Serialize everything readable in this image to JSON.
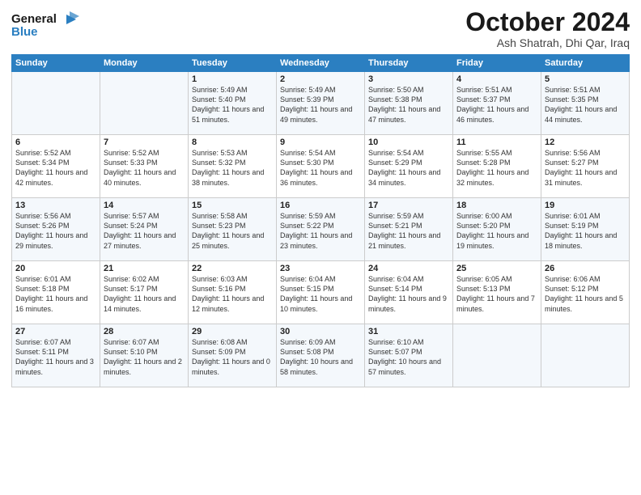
{
  "logo": {
    "line1": "General",
    "line2": "Blue"
  },
  "title": "October 2024",
  "subtitle": "Ash Shatrah, Dhi Qar, Iraq",
  "headers": [
    "Sunday",
    "Monday",
    "Tuesday",
    "Wednesday",
    "Thursday",
    "Friday",
    "Saturday"
  ],
  "weeks": [
    [
      {
        "day": "",
        "content": ""
      },
      {
        "day": "",
        "content": ""
      },
      {
        "day": "1",
        "content": "Sunrise: 5:49 AM\nSunset: 5:40 PM\nDaylight: 11 hours and 51 minutes."
      },
      {
        "day": "2",
        "content": "Sunrise: 5:49 AM\nSunset: 5:39 PM\nDaylight: 11 hours and 49 minutes."
      },
      {
        "day": "3",
        "content": "Sunrise: 5:50 AM\nSunset: 5:38 PM\nDaylight: 11 hours and 47 minutes."
      },
      {
        "day": "4",
        "content": "Sunrise: 5:51 AM\nSunset: 5:37 PM\nDaylight: 11 hours and 46 minutes."
      },
      {
        "day": "5",
        "content": "Sunrise: 5:51 AM\nSunset: 5:35 PM\nDaylight: 11 hours and 44 minutes."
      }
    ],
    [
      {
        "day": "6",
        "content": "Sunrise: 5:52 AM\nSunset: 5:34 PM\nDaylight: 11 hours and 42 minutes."
      },
      {
        "day": "7",
        "content": "Sunrise: 5:52 AM\nSunset: 5:33 PM\nDaylight: 11 hours and 40 minutes."
      },
      {
        "day": "8",
        "content": "Sunrise: 5:53 AM\nSunset: 5:32 PM\nDaylight: 11 hours and 38 minutes."
      },
      {
        "day": "9",
        "content": "Sunrise: 5:54 AM\nSunset: 5:30 PM\nDaylight: 11 hours and 36 minutes."
      },
      {
        "day": "10",
        "content": "Sunrise: 5:54 AM\nSunset: 5:29 PM\nDaylight: 11 hours and 34 minutes."
      },
      {
        "day": "11",
        "content": "Sunrise: 5:55 AM\nSunset: 5:28 PM\nDaylight: 11 hours and 32 minutes."
      },
      {
        "day": "12",
        "content": "Sunrise: 5:56 AM\nSunset: 5:27 PM\nDaylight: 11 hours and 31 minutes."
      }
    ],
    [
      {
        "day": "13",
        "content": "Sunrise: 5:56 AM\nSunset: 5:26 PM\nDaylight: 11 hours and 29 minutes."
      },
      {
        "day": "14",
        "content": "Sunrise: 5:57 AM\nSunset: 5:24 PM\nDaylight: 11 hours and 27 minutes."
      },
      {
        "day": "15",
        "content": "Sunrise: 5:58 AM\nSunset: 5:23 PM\nDaylight: 11 hours and 25 minutes."
      },
      {
        "day": "16",
        "content": "Sunrise: 5:59 AM\nSunset: 5:22 PM\nDaylight: 11 hours and 23 minutes."
      },
      {
        "day": "17",
        "content": "Sunrise: 5:59 AM\nSunset: 5:21 PM\nDaylight: 11 hours and 21 minutes."
      },
      {
        "day": "18",
        "content": "Sunrise: 6:00 AM\nSunset: 5:20 PM\nDaylight: 11 hours and 19 minutes."
      },
      {
        "day": "19",
        "content": "Sunrise: 6:01 AM\nSunset: 5:19 PM\nDaylight: 11 hours and 18 minutes."
      }
    ],
    [
      {
        "day": "20",
        "content": "Sunrise: 6:01 AM\nSunset: 5:18 PM\nDaylight: 11 hours and 16 minutes."
      },
      {
        "day": "21",
        "content": "Sunrise: 6:02 AM\nSunset: 5:17 PM\nDaylight: 11 hours and 14 minutes."
      },
      {
        "day": "22",
        "content": "Sunrise: 6:03 AM\nSunset: 5:16 PM\nDaylight: 11 hours and 12 minutes."
      },
      {
        "day": "23",
        "content": "Sunrise: 6:04 AM\nSunset: 5:15 PM\nDaylight: 11 hours and 10 minutes."
      },
      {
        "day": "24",
        "content": "Sunrise: 6:04 AM\nSunset: 5:14 PM\nDaylight: 11 hours and 9 minutes."
      },
      {
        "day": "25",
        "content": "Sunrise: 6:05 AM\nSunset: 5:13 PM\nDaylight: 11 hours and 7 minutes."
      },
      {
        "day": "26",
        "content": "Sunrise: 6:06 AM\nSunset: 5:12 PM\nDaylight: 11 hours and 5 minutes."
      }
    ],
    [
      {
        "day": "27",
        "content": "Sunrise: 6:07 AM\nSunset: 5:11 PM\nDaylight: 11 hours and 3 minutes."
      },
      {
        "day": "28",
        "content": "Sunrise: 6:07 AM\nSunset: 5:10 PM\nDaylight: 11 hours and 2 minutes."
      },
      {
        "day": "29",
        "content": "Sunrise: 6:08 AM\nSunset: 5:09 PM\nDaylight: 11 hours and 0 minutes."
      },
      {
        "day": "30",
        "content": "Sunrise: 6:09 AM\nSunset: 5:08 PM\nDaylight: 10 hours and 58 minutes."
      },
      {
        "day": "31",
        "content": "Sunrise: 6:10 AM\nSunset: 5:07 PM\nDaylight: 10 hours and 57 minutes."
      },
      {
        "day": "",
        "content": ""
      },
      {
        "day": "",
        "content": ""
      }
    ]
  ]
}
